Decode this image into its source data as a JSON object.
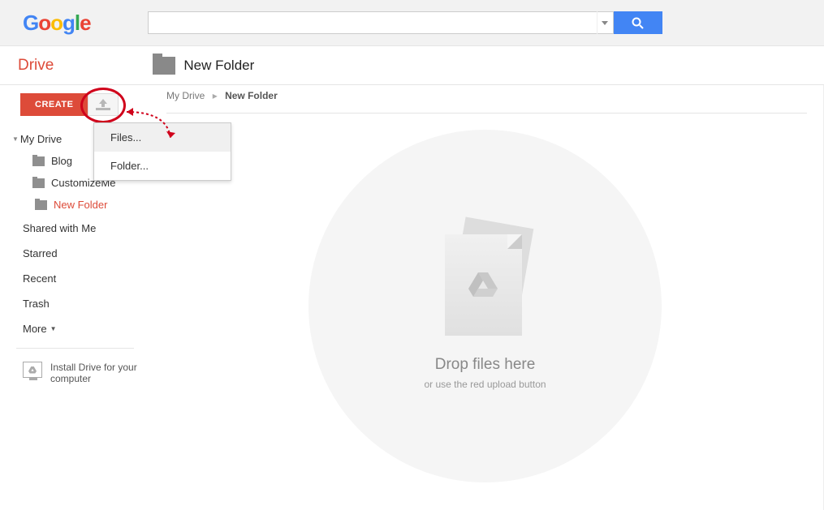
{
  "header": {
    "logo": {
      "letters": [
        "G",
        "o",
        "o",
        "g",
        "l",
        "e"
      ]
    },
    "search": {
      "placeholder": ""
    }
  },
  "app_title": "Drive",
  "current_folder_title": "New Folder",
  "breadcrumb": {
    "root": "My Drive",
    "current": "New Folder"
  },
  "sidebar": {
    "create_label": "CREATE",
    "my_drive_label": "My Drive",
    "folders": [
      {
        "label": "Blog"
      },
      {
        "label": "CustomizeMe"
      },
      {
        "label": "New Folder",
        "active": true
      }
    ],
    "nav": {
      "shared": "Shared with Me",
      "starred": "Starred",
      "recent": "Recent",
      "trash": "Trash",
      "more": "More"
    },
    "install_label": "Install Drive for your computer"
  },
  "upload_menu": {
    "files": "Files...",
    "folder": "Folder..."
  },
  "dropzone": {
    "title": "Drop files here",
    "subtitle": "or use the red upload button"
  }
}
